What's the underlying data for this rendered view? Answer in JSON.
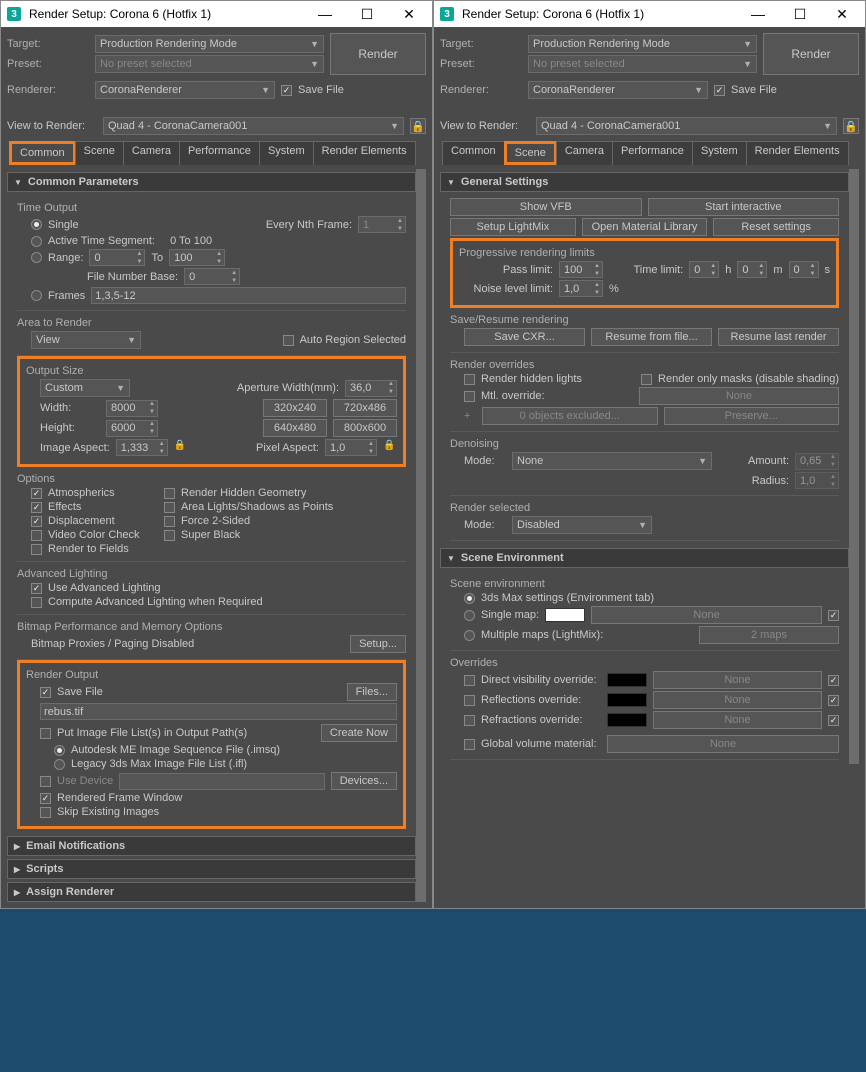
{
  "title": "Render Setup: Corona 6 (Hotfix 1)",
  "target_lbl": "Target:",
  "target": "Production Rendering Mode",
  "preset_lbl": "Preset:",
  "preset": "No preset selected",
  "renderer_lbl": "Renderer:",
  "renderer": "CoronaRenderer",
  "savefile_lbl": "Save File",
  "render_btn": "Render",
  "vtr_lbl": "View to Render:",
  "vtr": "Quad 4 - CoronaCamera001",
  "tabs": [
    "Common",
    "Scene",
    "Camera",
    "Performance",
    "System",
    "Render Elements"
  ],
  "cp": {
    "hdr": "Common Parameters",
    "to": {
      "t": "Time Output",
      "single": "Single",
      "enf": "Every Nth Frame:",
      "enf_v": "1",
      "ats": "Active Time Segment:",
      "ats_range": "0 To 100",
      "range": "Range:",
      "r0": "0",
      "r1": "100",
      "to_": "To",
      "fnb": "File Number Base:",
      "fnb_v": "0",
      "frames": "Frames",
      "frames_v": "1,3,5-12"
    },
    "atr": {
      "t": "Area to Render",
      "view": "View",
      "auto": "Auto Region Selected"
    },
    "os": {
      "t": "Output Size",
      "custom": "Custom",
      "awl": "Aperture Width(mm):",
      "aw": "36,0",
      "wl": "Width:",
      "w": "8000",
      "hl": "Height:",
      "h": "6000",
      "b1": "320x240",
      "b2": "720x486",
      "b3": "640x480",
      "b4": "800x600",
      "ial": "Image Aspect:",
      "ia": "1,333",
      "pal": "Pixel Aspect:",
      "pa": "1,0"
    },
    "opt": {
      "t": "Options",
      "a": "Atmospherics",
      "b": "Render Hidden Geometry",
      "c": "Effects",
      "d": "Area Lights/Shadows as Points",
      "e": "Displacement",
      "f": "Force 2-Sided",
      "g": "Video Color Check",
      "h": "Super Black",
      "i": "Render to Fields"
    },
    "al": {
      "t": "Advanced Lighting",
      "a": "Use Advanced Lighting",
      "b": "Compute Advanced Lighting when Required"
    },
    "bp": {
      "t": "Bitmap Performance and Memory Options",
      "a": "Bitmap Proxies / Paging Disabled",
      "b": "Setup..."
    },
    "ro": {
      "t": "Render Output",
      "sf": "Save File",
      "files": "Files...",
      "path": "rebus.tif",
      "put": "Put Image File List(s) in Output Path(s)",
      "cn": "Create Now",
      "a": "Autodesk ME Image Sequence File (.imsq)",
      "b": "Legacy 3ds Max Image File List (.ifl)",
      "ud": "Use Device",
      "dev": "Devices...",
      "rfw": "Rendered Frame Window",
      "sei": "Skip Existing Images"
    }
  },
  "en": "Email Notifications",
  "sc": "Scripts",
  "ar": "Assign Renderer",
  "gs": {
    "hdr": "General Settings",
    "sv": "Show VFB",
    "si": "Start interactive",
    "sl": "Setup LightMix",
    "oml": "Open Material Library",
    "rs": "Reset settings",
    "prl": {
      "t": "Progressive rendering limits",
      "pl": "Pass limit:",
      "pl_v": "100",
      "tl": "Time limit:",
      "t0": "0",
      "h": "h",
      "m": "m",
      "s": "s",
      "nl": "Noise level limit:",
      "nl_v": "1,0",
      "pct": "%"
    },
    "sr": {
      "t": "Save/Resume rendering",
      "a": "Save CXR...",
      "b": "Resume from file...",
      "c": "Resume last render"
    },
    "rov": {
      "t": "Render overrides",
      "hl": "Render hidden lights",
      "rom": "Render only masks (disable shading)",
      "mo": "Mtl. override:",
      "none": "None",
      "oe": "0 objects excluded...",
      "pr": "Preserve..."
    },
    "dn": {
      "t": "Denoising",
      "ml": "Mode:",
      "m": "None",
      "al": "Amount:",
      "a": "0,65",
      "rl": "Radius:",
      "r": "1,0"
    },
    "rsel": {
      "t": "Render selected",
      "ml": "Mode:",
      "m": "Disabled"
    }
  },
  "se": {
    "hdr": "Scene Environment",
    "t": "Scene environment",
    "a": "3ds Max settings (Environment tab)",
    "b": "Single map:",
    "c": "Multiple maps (LightMix):",
    "none": "None",
    "maps": "2 maps",
    "ov": {
      "t": "Overrides",
      "d": "Direct visibility override:",
      "r": "Reflections override:",
      "rf": "Refractions override:",
      "g": "Global volume material:",
      "none": "None"
    }
  }
}
